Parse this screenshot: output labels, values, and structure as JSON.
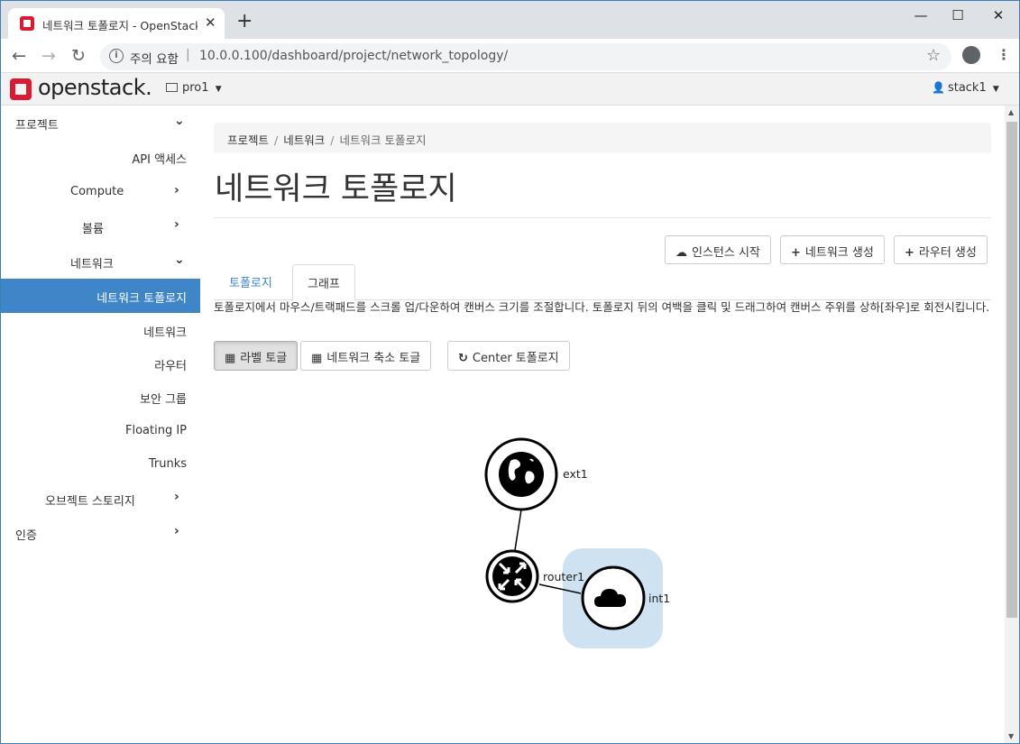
{
  "browser": {
    "tab_title": "네트워크 토폴로지 - OpenStack Dashboard",
    "tab_close": "✕",
    "new_tab": "+",
    "security_label": "주의 요함",
    "url": "10.0.0.100/dashboard/project/network_topology/",
    "window_controls": {
      "minimize": "—",
      "maximize": "☐",
      "close": "✕"
    }
  },
  "header": {
    "logo_text": "openstack.",
    "project_selector": "pro1",
    "user_menu": "stack1"
  },
  "sidebar": {
    "items": [
      {
        "label": "프로젝트",
        "chevron": "down"
      },
      {
        "label": "API 액세스"
      },
      {
        "label": "Compute",
        "chevron": "right"
      },
      {
        "label": "볼륨",
        "chevron": "right"
      },
      {
        "label": "네트워크",
        "chevron": "down"
      },
      {
        "label": "네트워크 토폴로지",
        "active": true
      },
      {
        "label": "네트워크"
      },
      {
        "label": "라우터"
      },
      {
        "label": "보안 그룹"
      },
      {
        "label": "Floating IP"
      },
      {
        "label": "Trunks"
      },
      {
        "label": "오브젝트 스토리지",
        "chevron": "right"
      },
      {
        "label": "인증",
        "chevron": "right"
      }
    ]
  },
  "main": {
    "breadcrumb": [
      "프로젝트",
      "네트워크",
      "네트워크 토폴로지"
    ],
    "page_title": "네트워크 토폴로지",
    "actions": {
      "launch_instance": "인스턴스 시작",
      "create_network": "네트워크 생성",
      "create_router": "라우터 생성"
    },
    "tabs": [
      "토폴로지",
      "그래프"
    ],
    "active_tab": "그래프",
    "help_text": "토폴로지에서 마우스/트랙패드를 스크롤 업/다운하여 캔버스 크기를 조절합니다. 토폴로지 뒤의 여백을 클릭 및 드래그하여 캔버스 주위를 상하[좌우]로 회전시킵니다.",
    "graph_controls": {
      "toggle_labels": "라벨 토글",
      "toggle_network_collapse": "네트워크 축소 토글",
      "center_topology": "Center 토폴로지"
    },
    "topology": {
      "nodes": [
        {
          "name": "ext1",
          "type": "external-network"
        },
        {
          "name": "router1",
          "type": "router"
        },
        {
          "name": "int1",
          "type": "network"
        }
      ],
      "links": [
        [
          "ext1",
          "router1"
        ],
        [
          "router1",
          "int1"
        ]
      ],
      "colors": {
        "network_highlight": "#cfe2f1",
        "node_stroke": "#000000"
      }
    }
  },
  "colors": {
    "accent": "#3f86c8",
    "brand_red": "#da1a32"
  }
}
